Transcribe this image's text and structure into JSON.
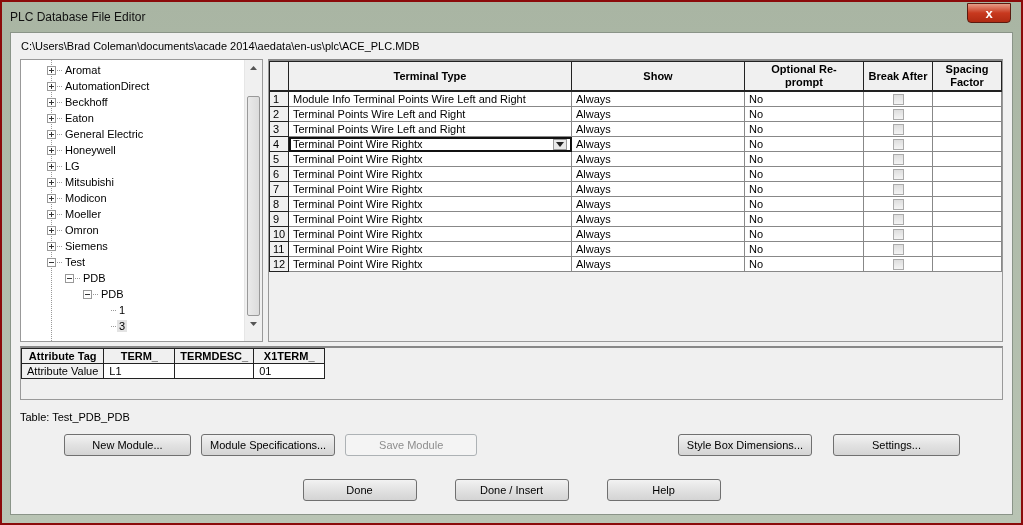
{
  "window": {
    "title": "PLC Database File Editor",
    "close_label": "x"
  },
  "path": "C:\\Users\\Brad Coleman\\documents\\acade 2014\\aedata\\en-us\\plc\\ACE_PLC.MDB",
  "tree": {
    "items": [
      {
        "label": "Aromat",
        "expanded": false,
        "selected": false
      },
      {
        "label": "AutomationDirect",
        "expanded": false,
        "selected": false
      },
      {
        "label": "Beckhoff",
        "expanded": false,
        "selected": false
      },
      {
        "label": "Eaton",
        "expanded": false,
        "selected": false
      },
      {
        "label": "General Electric",
        "expanded": false,
        "selected": false
      },
      {
        "label": "Honeywell",
        "expanded": false,
        "selected": false
      },
      {
        "label": "LG",
        "expanded": false,
        "selected": false
      },
      {
        "label": "Mitsubishi",
        "expanded": false,
        "selected": false
      },
      {
        "label": "Modicon",
        "expanded": false,
        "selected": false
      },
      {
        "label": "Moeller",
        "expanded": false,
        "selected": false
      },
      {
        "label": "Omron",
        "expanded": false,
        "selected": false
      },
      {
        "label": "Siemens",
        "expanded": false,
        "selected": false
      },
      {
        "label": "Test",
        "expanded": true,
        "selected": false,
        "children": [
          {
            "label": "PDB",
            "expanded": true,
            "selected": false,
            "children": [
              {
                "label": "PDB",
                "expanded": true,
                "selected": false,
                "children": [
                  {
                    "label": "1",
                    "selected": false
                  },
                  {
                    "label": "3",
                    "selected": true
                  }
                ]
              }
            ]
          }
        ]
      }
    ]
  },
  "grid": {
    "columns": [
      "Terminal Type",
      "Show",
      "Optional Re-prompt",
      "Break After",
      "Spacing Factor"
    ],
    "rows": [
      {
        "number": "1",
        "terminal_type": "Module Info Terminal Points Wire Left and Right",
        "show": "Always",
        "optional_reprompt": "No",
        "break_after": false,
        "editing": false
      },
      {
        "number": "2",
        "terminal_type": "Terminal Points Wire Left and Right",
        "show": "Always",
        "optional_reprompt": "No",
        "break_after": false,
        "editing": false
      },
      {
        "number": "3",
        "terminal_type": "Terminal Points Wire Left and Right",
        "show": "Always",
        "optional_reprompt": "No",
        "break_after": false,
        "editing": false
      },
      {
        "number": "4",
        "terminal_type": "Terminal Point Wire Rightx",
        "show": "Always",
        "optional_reprompt": "No",
        "break_after": false,
        "editing": true
      },
      {
        "number": "5",
        "terminal_type": "Terminal Point Wire Rightx",
        "show": "Always",
        "optional_reprompt": "No",
        "break_after": false,
        "editing": false
      },
      {
        "number": "6",
        "terminal_type": "Terminal Point Wire Rightx",
        "show": "Always",
        "optional_reprompt": "No",
        "break_after": false,
        "editing": false
      },
      {
        "number": "7",
        "terminal_type": "Terminal Point Wire Rightx",
        "show": "Always",
        "optional_reprompt": "No",
        "break_after": false,
        "editing": false
      },
      {
        "number": "8",
        "terminal_type": "Terminal Point Wire Rightx",
        "show": "Always",
        "optional_reprompt": "No",
        "break_after": false,
        "editing": false
      },
      {
        "number": "9",
        "terminal_type": "Terminal Point Wire Rightx",
        "show": "Always",
        "optional_reprompt": "No",
        "break_after": false,
        "editing": false
      },
      {
        "number": "10",
        "terminal_type": "Terminal Point Wire Rightx",
        "show": "Always",
        "optional_reprompt": "No",
        "break_after": false,
        "editing": false
      },
      {
        "number": "11",
        "terminal_type": "Terminal Point Wire Rightx",
        "show": "Always",
        "optional_reprompt": "No",
        "break_after": false,
        "editing": false
      },
      {
        "number": "12",
        "terminal_type": "Terminal Point Wire Rightx",
        "show": "Always",
        "optional_reprompt": "No",
        "break_after": false,
        "editing": false
      }
    ]
  },
  "attributes": {
    "tag_header": "Attribute Tag",
    "value_header": "Attribute Value",
    "columns": [
      {
        "tag": "TERM_",
        "value": "L1"
      },
      {
        "tag": "TERMDESC_"
      },
      {
        "tag": "X1TERM_",
        "value": "01"
      }
    ]
  },
  "table_label": "Table: Test_PDB_PDB",
  "module_buttons": [
    {
      "label": "New Module...",
      "disabled": false
    },
    {
      "label": "Module Specifications...",
      "disabled": false
    },
    {
      "label": "Save Module",
      "disabled": true
    }
  ],
  "setting_buttons": [
    {
      "label": "Style Box Dimensions...",
      "disabled": false
    },
    {
      "label": "Settings...",
      "disabled": false
    }
  ],
  "buttons_row_2": [
    {
      "label": "Done",
      "disabled": false
    },
    {
      "label": "Done / Insert",
      "disabled": false
    },
    {
      "label": "Help",
      "disabled": false
    }
  ]
}
